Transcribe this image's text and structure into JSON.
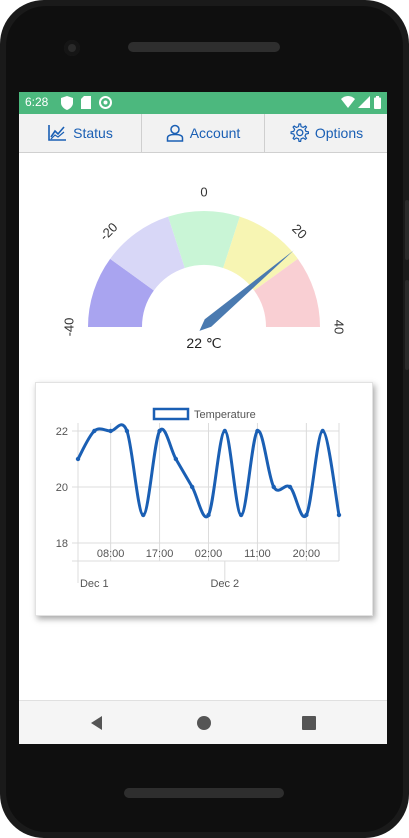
{
  "statusbar": {
    "time": "6:28",
    "bg": "#4CB87E",
    "left_icons": [
      "shield-icon",
      "sim-card-icon",
      "circular-sync-icon"
    ],
    "right_icons": [
      "wifi-icon",
      "signal-icon",
      "battery-icon"
    ]
  },
  "tabs": [
    {
      "label": "Status",
      "icon": "chart-line-icon"
    },
    {
      "label": "Account",
      "icon": "user-icon"
    },
    {
      "label": "Options",
      "icon": "gear-icon"
    }
  ],
  "gauge": {
    "value": 22,
    "unit": "℃",
    "readout": "22 ℃",
    "ticks": [
      "-40",
      "-20",
      "0",
      "20",
      "40"
    ],
    "min": -40,
    "max": 40,
    "bands": [
      {
        "from": -40,
        "to": -24,
        "color": "#a9a4f0"
      },
      {
        "from": -24,
        "to": -8,
        "color": "#d8d7f7"
      },
      {
        "from": -8,
        "to": 8,
        "color": "#c9f5d6"
      },
      {
        "from": 8,
        "to": 24,
        "color": "#f7f5b3"
      },
      {
        "from": 24,
        "to": 40,
        "color": "#f9cfd3"
      }
    ],
    "needle_color": "#4a7ab0"
  },
  "chart_data": {
    "type": "line",
    "legend": "Temperature",
    "series_color": "#1a5fb4",
    "y_ticks": [
      "22",
      "20",
      "18"
    ],
    "ylim": [
      18,
      22
    ],
    "x_ticks_time": [
      "08:00",
      "17:00",
      "02:00",
      "11:00",
      "20:00"
    ],
    "x_ticks_date": [
      "Dec 1",
      "Dec 2"
    ],
    "x_hours": [
      0,
      3,
      6,
      9,
      12,
      15,
      18,
      21,
      24,
      27,
      30,
      33,
      36,
      39,
      42,
      45
    ],
    "values": [
      21.0,
      22.0,
      22.0,
      22.0,
      19.0,
      22.0,
      21.0,
      20.0,
      19.0,
      22.0,
      19.0,
      22.0,
      20.0,
      20.0,
      19.0,
      22.0,
      19.0
    ]
  }
}
